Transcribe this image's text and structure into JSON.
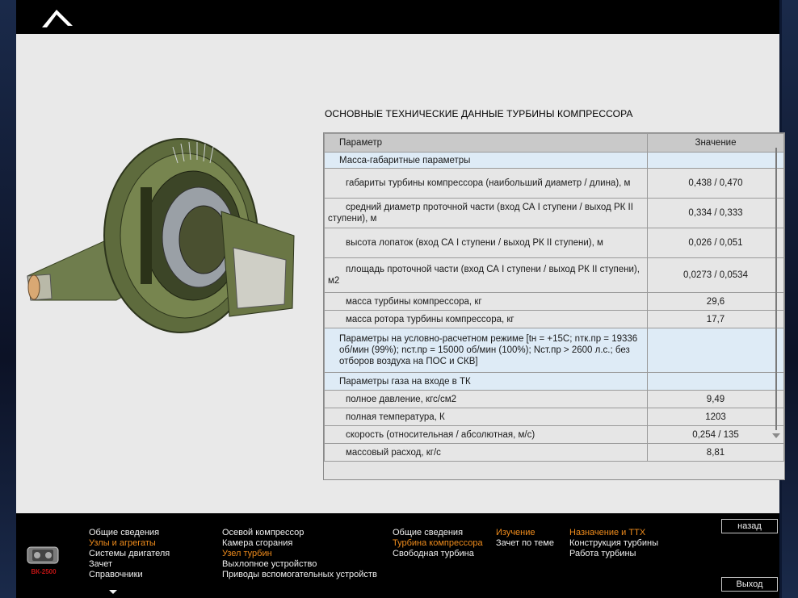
{
  "title": "ОСНОВНЫЕ ТЕХНИЧЕСКИЕ ДАННЫЕ ТУРБИНЫ КОМПРЕССОРА",
  "table": {
    "headers": {
      "param": "Параметр",
      "value": "Значение"
    },
    "rows": [
      {
        "type": "section",
        "param": "Масса-габаритные параметры",
        "value": ""
      },
      {
        "type": "item",
        "param": "габариты турбины компрессора (наибольший диаметр / длина), м",
        "value": "0,438 / 0,470"
      },
      {
        "type": "item",
        "param": "средний диаметр проточной части (вход СА I ступени / выход РК II ступени), м",
        "value": "0,334 / 0,333"
      },
      {
        "type": "item",
        "param": "высота лопаток (вход СА I ступени / выход РК II ступени), м",
        "value": "0,026 / 0,051"
      },
      {
        "type": "item",
        "param": "площадь проточной части (вход СА I ступени / выход РК II ступени), м2",
        "value": "0,0273 / 0,0534"
      },
      {
        "type": "item",
        "param": "масса турбины компрессора, кг",
        "value": "29,6"
      },
      {
        "type": "item",
        "param": "масса ротора турбины компрессора, кг",
        "value": "17,7"
      },
      {
        "type": "section",
        "param": "Параметры на условно-расчетном режиме [tн = +15С; nтк.пр = 19336 об/мин (99%); nст.пр = 15000 об/мин (100%); Nст.пр > 2600 л.с.; без отборов воздуха на ПОС и СКВ]",
        "value": ""
      },
      {
        "type": "section",
        "param": "Параметры газа на входе в ТК",
        "value": ""
      },
      {
        "type": "item",
        "param": "полное давление, кгс/см2",
        "value": "9,49"
      },
      {
        "type": "item",
        "param": "полная температура, К",
        "value": "1203"
      },
      {
        "type": "item",
        "param": "скорость (относительная / абсолютная, м/с)",
        "value": "0,254 / 135"
      },
      {
        "type": "item",
        "param": "массовый расход, кг/с",
        "value": "8,81"
      }
    ]
  },
  "footer": {
    "logo_text": "ВК-2500",
    "col1": [
      "Общие сведения",
      "Узлы и агрегаты",
      "Системы двигателя",
      "Зачет",
      "Справочники"
    ],
    "col2": [
      "Осевой компрессор",
      "Камера сгорания",
      "Узел турбин",
      "Выхлопное устройство",
      "Приводы вспомогательных устройств"
    ],
    "col3": [
      "Общие сведения",
      "Турбина компрессора",
      "Свободная турбина"
    ],
    "col4": [
      "Изучение",
      "Зачет по теме"
    ],
    "col5": [
      "Назначение и ТТХ",
      "Конструкция турбины",
      "Работа турбины"
    ],
    "back_label": "назад",
    "exit_label": "Выход"
  },
  "colors": {
    "accent_orange": "#f08c1c",
    "section_row_bg": "#deebf6",
    "header_row_bg": "#c9c9c9"
  }
}
